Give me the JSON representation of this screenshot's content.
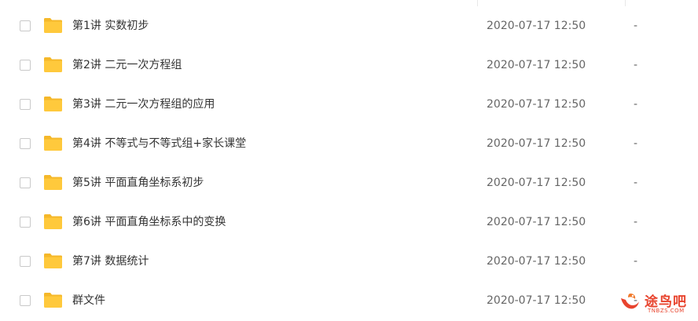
{
  "colors": {
    "folder": "#FFC93C",
    "folder_back": "#F5B82A",
    "text": "#333333",
    "meta_text": "#666666",
    "watermark": "#E8442E"
  },
  "rows": [
    {
      "name": "第1讲 实数初步",
      "modified": "2020-07-17 12:50",
      "size": "-"
    },
    {
      "name": "第2讲 二元一次方程组",
      "modified": "2020-07-17 12:50",
      "size": "-"
    },
    {
      "name": "第3讲 二元一次方程组的应用",
      "modified": "2020-07-17 12:50",
      "size": "-"
    },
    {
      "name": "第4讲 不等式与不等式组+家长课堂",
      "modified": "2020-07-17 12:50",
      "size": "-"
    },
    {
      "name": "第5讲 平面直角坐标系初步",
      "modified": "2020-07-17 12:50",
      "size": "-"
    },
    {
      "name": "第6讲 平面直角坐标系中的变换",
      "modified": "2020-07-17 12:50",
      "size": "-"
    },
    {
      "name": "第7讲 数据统计",
      "modified": "2020-07-17 12:50",
      "size": "-"
    },
    {
      "name": "群文件",
      "modified": "2020-07-17 12:50",
      "size": "-"
    }
  ],
  "watermark": {
    "name": "途鸟吧",
    "url": "TNBZS.COM"
  }
}
